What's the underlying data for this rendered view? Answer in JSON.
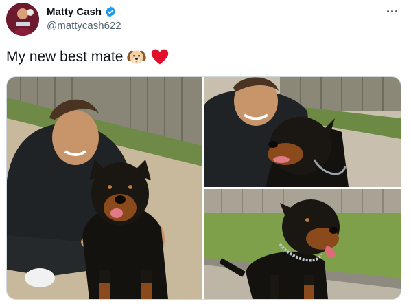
{
  "tweet": {
    "author": {
      "name": "Matty Cash",
      "handle": "@mattycash622",
      "avatar_icon": "profile-avatar",
      "verified_color": "#1d9bf0"
    },
    "text": "My new best mate",
    "emojis": [
      "dog-face-emoji",
      "red-heart-emoji"
    ],
    "photos": [
      {
        "label": "man-crouching-with-rottweiler"
      },
      {
        "label": "man-smiling-at-rottweiler"
      },
      {
        "label": "rottweiler-on-grass"
      }
    ]
  }
}
